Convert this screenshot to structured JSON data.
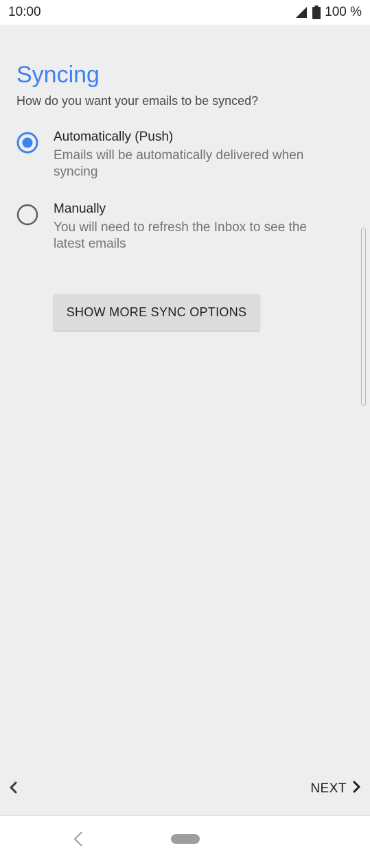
{
  "status_bar": {
    "time": "10:00",
    "battery_text": "100 %",
    "icons": [
      "signal-icon",
      "battery-icon"
    ]
  },
  "page": {
    "title": "Syncing",
    "subtitle": "How do you want your emails to be synced?"
  },
  "options": [
    {
      "label": "Automatically (Push)",
      "description_line1": "Emails will be automatically delivered when",
      "description_line2": "syncing",
      "selected": true
    },
    {
      "label": "Manually",
      "description_line1": "You will need to refresh the Inbox to see the",
      "description_line2": "latest emails",
      "selected": false
    }
  ],
  "more_options_button": "SHOW MORE SYNC OPTIONS",
  "footer": {
    "back_icon": "chevron-left-icon",
    "next_label": "NEXT",
    "next_icon": "chevron-right-icon"
  },
  "colors": {
    "accent": "#3c82f2",
    "background": "#eeeeee",
    "button": "#dcdcdc"
  }
}
